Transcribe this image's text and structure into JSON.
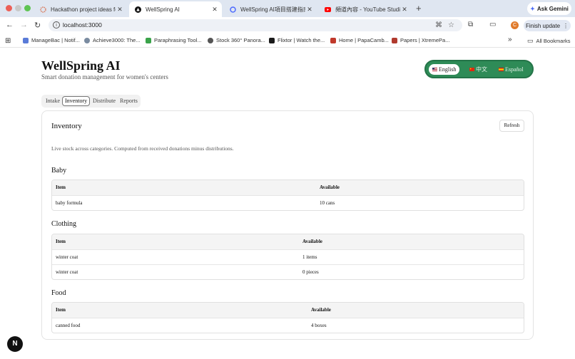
{
  "browser": {
    "tabs": [
      {
        "title": "Hackathon project ideas for s",
        "active": false
      },
      {
        "title": "WellSpring AI",
        "active": true
      },
      {
        "title": "WellSpring AI項目搭建指南说明",
        "active": false
      },
      {
        "title": "頻道內容 - YouTube Studio",
        "active": false
      }
    ],
    "new_tab": "+",
    "gemini_label": "Ask Gemini",
    "url": "localhost:3000",
    "finish_update": "Finish update",
    "profile_initial": "C",
    "bookmarks": [
      {
        "label": "ManageBac | Notif..."
      },
      {
        "label": "Achieve3000: The..."
      },
      {
        "label": "Paraphrasing Tool..."
      },
      {
        "label": "Stock 360° Panora..."
      },
      {
        "label": "Flixtor | Watch the..."
      },
      {
        "label": "Home | PapaCamb..."
      },
      {
        "label": "Papers | XtremePa..."
      }
    ],
    "all_bookmarks": "All Bookmarks",
    "overflow": "»"
  },
  "app": {
    "title": "WellSpring AI",
    "subtitle": "Smart donation management for women's centers",
    "languages": [
      {
        "label": "English",
        "active": true
      },
      {
        "label": "中文",
        "active": false
      },
      {
        "label": "Español",
        "active": false
      }
    ],
    "tabs": [
      {
        "label": "Intake",
        "active": false
      },
      {
        "label": "Inventory",
        "active": true
      },
      {
        "label": "Distribute",
        "active": false
      },
      {
        "label": "Reports",
        "active": false
      }
    ]
  },
  "inventory": {
    "title": "Inventory",
    "refresh_label": "Refresh",
    "description": "Live stock across categories. Computed from received donations minus distributions.",
    "columns": {
      "item": "Item",
      "available": "Available"
    },
    "categories": [
      {
        "name": "Baby",
        "rows": [
          {
            "item": "baby formula",
            "available": "10 cans"
          }
        ]
      },
      {
        "name": "Clothing",
        "rows": [
          {
            "item": "winter coat",
            "available": "1 items"
          },
          {
            "item": "winter coat",
            "available": "0 pieces"
          }
        ]
      },
      {
        "name": "Food",
        "rows": [
          {
            "item": "canned food",
            "available": "4 boxes"
          }
        ]
      }
    ]
  },
  "badge_letter": "N",
  "colors": {
    "brand_green": "#2e8b57",
    "tabstrip": "#dfe6f1"
  }
}
